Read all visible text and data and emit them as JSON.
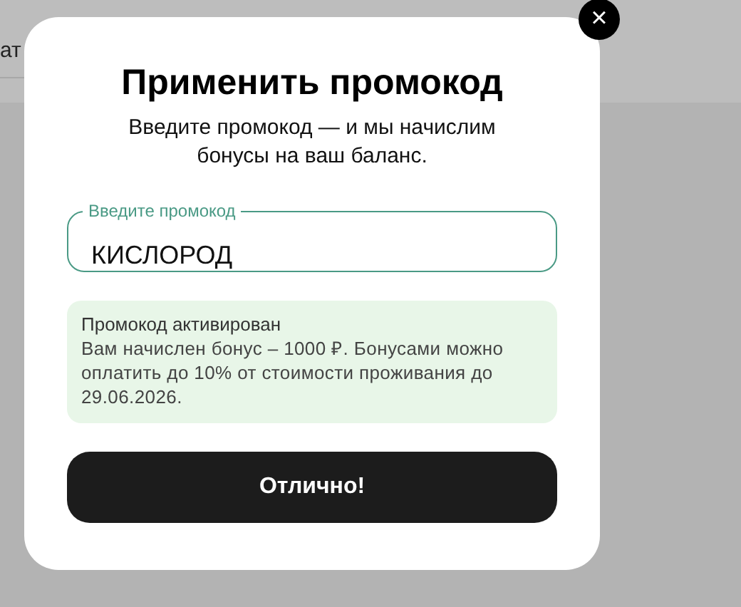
{
  "background": {
    "fragment": "ат"
  },
  "dialog": {
    "close": "×",
    "title": "Применить промокод",
    "subtitle": "Введите промокод — и мы начислим бонусы на ваш баланс.",
    "field": {
      "label": "Введите промокод",
      "value": "КИСЛОРОД"
    },
    "notice": {
      "title": "Промокод активирован",
      "text": "Вам начислен бонус – 1000 ₽. Бонусами можно оплатить до 10% от стоимости проживания до 29.06.2026."
    },
    "button": "Отлично!"
  }
}
